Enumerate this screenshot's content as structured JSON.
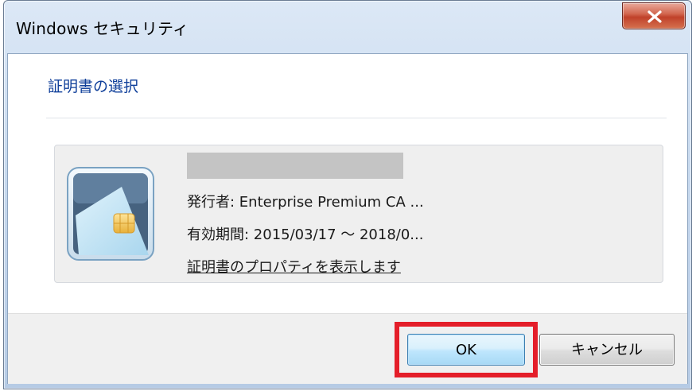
{
  "window": {
    "title": "Windows セキュリティ",
    "close_icon": "close-x-icon"
  },
  "dialog": {
    "heading": "証明書の選択",
    "certificate": {
      "icon": "smartcard-icon",
      "subject": "",
      "issuer": "発行者: Enterprise Premium CA ...",
      "validity": "有効期間: 2015/03/17 ～ 2018/0...",
      "properties_link": "証明書のプロパティを表示します"
    }
  },
  "buttons": {
    "ok": "OK",
    "cancel": "キャンセル"
  },
  "colors": {
    "heading": "#0f3f9a",
    "highlight": "#e41e2a",
    "close_button": "#c0412a"
  }
}
